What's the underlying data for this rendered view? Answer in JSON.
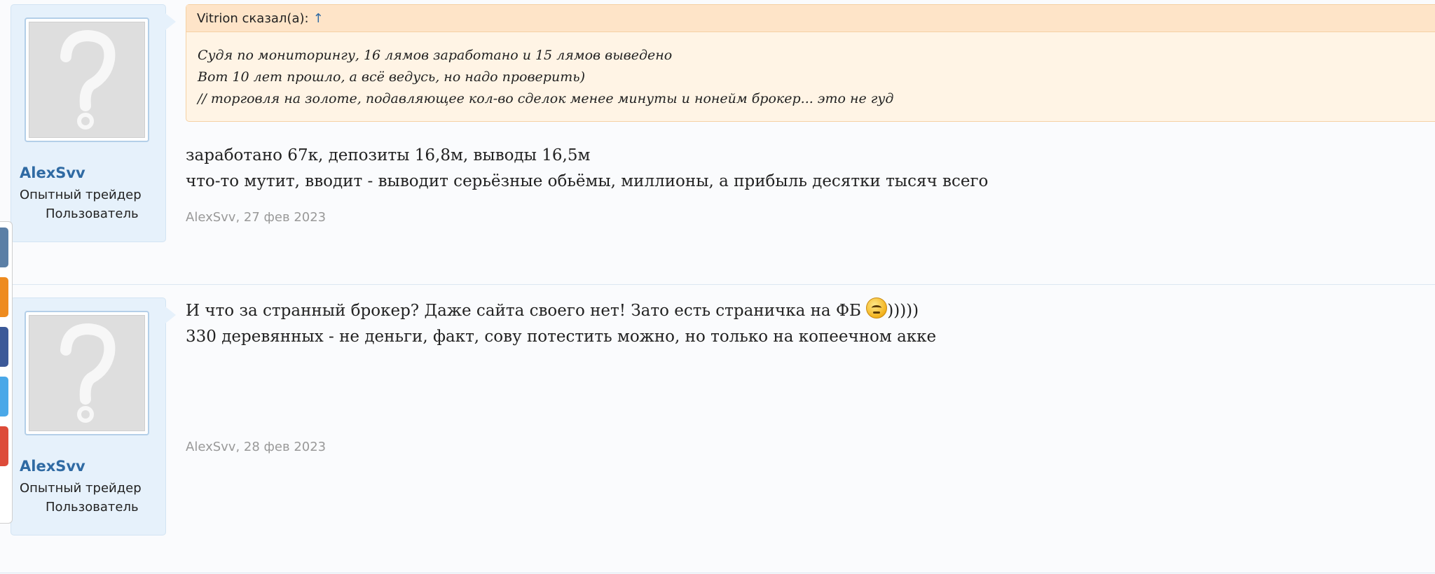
{
  "posts": [
    {
      "username": "AlexSvv",
      "user_title": "Опытный трейдер",
      "user_role": "Пользователь",
      "quote": {
        "author_label": "Vitrion сказал(а):",
        "arrow": "↑",
        "lines": [
          "Судя по мониторингу, 16 лямов заработано и 15 лямов выведено",
          "Вот 10 лет прошло, а всё ведусь, но надо проверить)",
          "// торговля на золоте, подавляющее кол-во сделок менее минуты и нонейм брокер... это не гуд"
        ]
      },
      "lines": [
        "заработано 67к, депозиты 16,8м, выводы 16,5м",
        "что-то мутит, вводит - выводит серьёзные обьёмы, миллионы, а прибыль десятки тысяч всего"
      ],
      "meta": "AlexSvv, 27 фев 2023"
    },
    {
      "username": "AlexSvv",
      "user_title": "Опытный трейдер",
      "user_role": "Пользователь",
      "line1_before": "И что за странный брокер? Даже сайта своего нет! Зато есть страничка на ФБ ",
      "line1_after": ")))))",
      "line2": "330 деревянных - не деньги, факт, сову потестить можно, но только на копеечном акке",
      "meta": "AlexSvv, 28 фев 2023"
    }
  ],
  "share_colors": [
    "#5b7fa6",
    "#ee8b1f",
    "#3b5998",
    "#4aa8e8",
    "#dd4b39"
  ],
  "icons": {
    "avatar": "default-avatar-icon",
    "smiley": "smiley-icon"
  }
}
